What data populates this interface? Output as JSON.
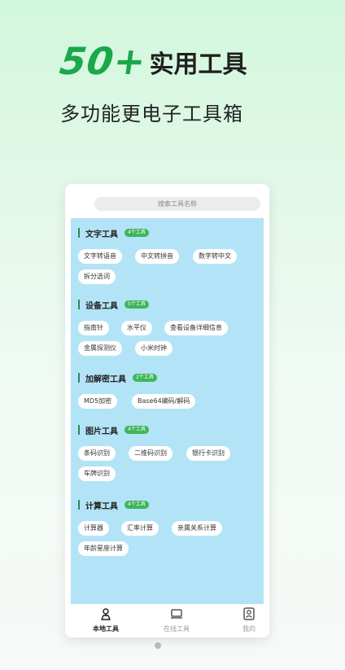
{
  "hero": {
    "big": "50+",
    "small": "实用工具"
  },
  "subtitle": "多功能更电子工具箱",
  "search": {
    "placeholder": "搜索工具名称"
  },
  "sections": [
    {
      "title": "文字工具",
      "badge": "4个工具",
      "chips": [
        "文字转语音",
        "中文转拼音",
        "数字转中文",
        "拆分选词"
      ]
    },
    {
      "title": "设备工具",
      "badge": "5个工具",
      "chips": [
        "指南针",
        "水平仪",
        "查看设备详细信息",
        "金属探测仪",
        "小米时钟"
      ]
    },
    {
      "title": "加解密工具",
      "badge": "2个工具",
      "chips": [
        "MD5加密",
        "Base64编码/解码"
      ]
    },
    {
      "title": "图片工具",
      "badge": "4个工具",
      "chips": [
        "条码识别",
        "二维码识别",
        "银行卡识别",
        "车牌识别"
      ]
    },
    {
      "title": "计算工具",
      "badge": "4个工具",
      "chips": [
        "计算器",
        "汇率计算",
        "亲属关系计算",
        "年龄星座计算"
      ]
    }
  ],
  "tabs": [
    {
      "label": "本地工具",
      "icon": "local-tools-icon",
      "active": true
    },
    {
      "label": "在线工具",
      "icon": "online-tools-icon",
      "active": false
    },
    {
      "label": "我的",
      "icon": "profile-icon",
      "active": false
    }
  ],
  "colors": {
    "accent": "#19a84a",
    "badge": "#3fb55a",
    "content_bg": "#b3e3f6"
  }
}
